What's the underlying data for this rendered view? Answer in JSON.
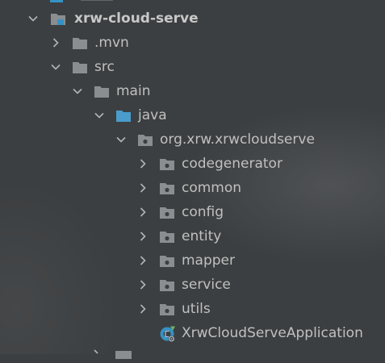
{
  "project_tree": {
    "root": {
      "label": "xrw-cloud-serve",
      "icon": "project-folder-icon",
      "expanded": true
    },
    "items": [
      {
        "label": ".mvn",
        "icon": "folder-icon",
        "expanded": false
      },
      {
        "label": "src",
        "icon": "folder-icon",
        "expanded": true
      },
      {
        "label": "main",
        "icon": "folder-icon",
        "expanded": true
      },
      {
        "label": "java",
        "icon": "source-folder-icon",
        "expanded": true
      },
      {
        "label": "org.xrw.xrwcloudserve",
        "icon": "package-icon",
        "expanded": true
      },
      {
        "label": "codegenerator",
        "icon": "package-icon",
        "expanded": false
      },
      {
        "label": "common",
        "icon": "package-icon",
        "expanded": false
      },
      {
        "label": "config",
        "icon": "package-icon",
        "expanded": false
      },
      {
        "label": "entity",
        "icon": "package-icon",
        "expanded": false
      },
      {
        "label": "mapper",
        "icon": "package-icon",
        "expanded": false
      },
      {
        "label": "service",
        "icon": "package-icon",
        "expanded": false
      },
      {
        "label": "utils",
        "icon": "package-icon",
        "expanded": false
      },
      {
        "label": "XrwCloudServeApplication",
        "icon": "spring-boot-class-icon"
      }
    ]
  },
  "colors": {
    "background": "#3c3f41",
    "text": "#c0c0c0",
    "folder": "#8a8e91",
    "source_folder": "#4a9ccb",
    "chevron": "#b4b4b4",
    "spring_green": "#6bb26a"
  }
}
